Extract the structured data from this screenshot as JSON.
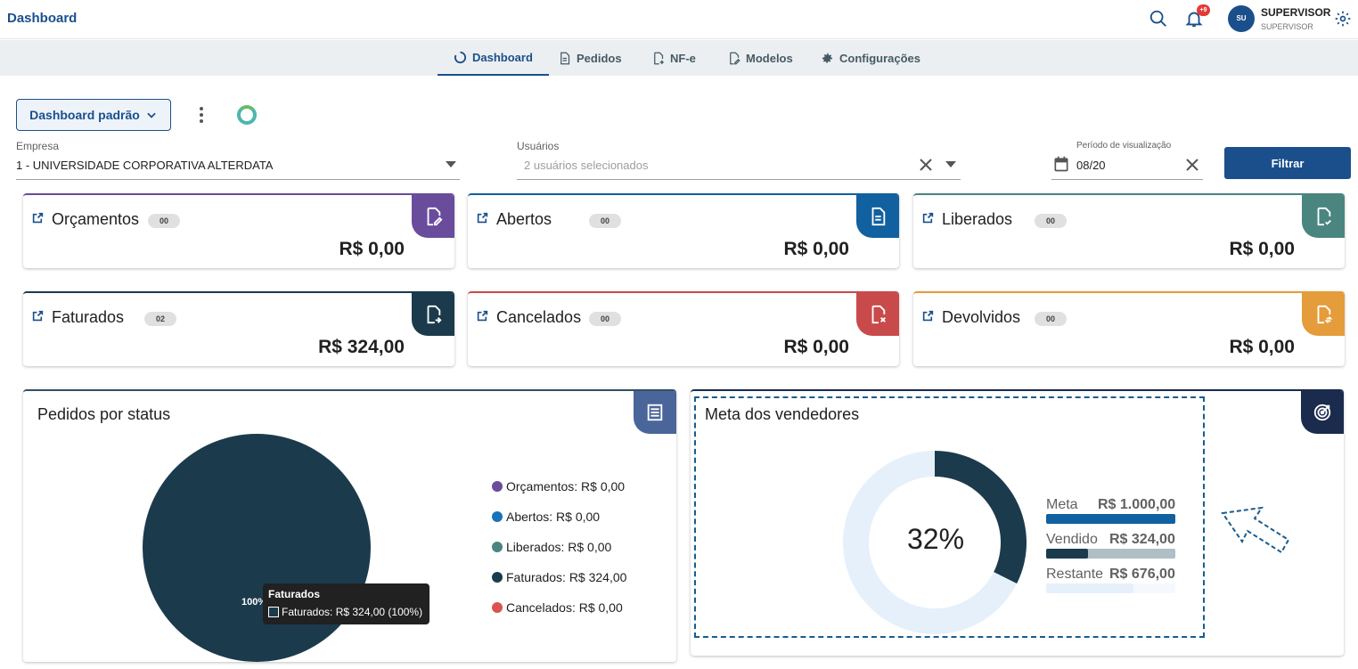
{
  "header": {
    "title": "Dashboard",
    "notification_badge": "+9",
    "user_initials": "SU",
    "user_name": "SUPERVISOR",
    "user_role": "SUPERVISOR"
  },
  "nav": {
    "tabs": [
      {
        "label": "Dashboard",
        "icon": "loading-circle-icon",
        "active": true
      },
      {
        "label": "Pedidos",
        "icon": "document-icon",
        "active": false
      },
      {
        "label": "NF-e",
        "icon": "document-arrow-icon",
        "active": false
      },
      {
        "label": "Modelos",
        "icon": "document-edit-icon",
        "active": false
      },
      {
        "label": "Configurações",
        "icon": "gear-icon",
        "active": false
      }
    ]
  },
  "toolbar": {
    "dashboard_select": "Dashboard padrão"
  },
  "filters": {
    "empresa_label": "Empresa",
    "empresa_value": "1 - UNIVERSIDADE CORPORATIVA ALTERDATA",
    "usuarios_label": "Usuários",
    "usuarios_value": "2 usuários selecionados",
    "periodo_label": "Período de visualização",
    "periodo_value": "08/20",
    "filter_button": "Filtrar"
  },
  "kpis": [
    {
      "name": "Orçamentos",
      "count": "00",
      "value": "R$ 0,00",
      "color": "#6a4c9c",
      "icon": "document-edit-icon"
    },
    {
      "name": "Abertos",
      "count": "00",
      "value": "R$ 0,00",
      "color": "#11609f",
      "icon": "document-icon"
    },
    {
      "name": "Liberados",
      "count": "00",
      "value": "R$ 0,00",
      "color": "#4a8580",
      "icon": "document-check-icon"
    },
    {
      "name": "Faturados",
      "count": "02",
      "value": "R$ 324,00",
      "color": "#1b3b4d",
      "icon": "document-arrow-icon"
    },
    {
      "name": "Cancelados",
      "count": "00",
      "value": "R$ 0,00",
      "color": "#c94a4a",
      "icon": "document-x-icon"
    },
    {
      "name": "Devolvidos",
      "count": "00",
      "value": "R$ 0,00",
      "color": "#e59c3a",
      "icon": "document-return-icon"
    }
  ],
  "status_panel": {
    "title": "Pedidos por status",
    "slice_label": "100%",
    "legend": [
      {
        "label": "Orçamentos: R$ 0,00",
        "color": "#6a4c9c"
      },
      {
        "label": "Abertos: R$ 0,00",
        "color": "#1a72b8"
      },
      {
        "label": "Liberados: R$ 0,00",
        "color": "#4a8580"
      },
      {
        "label": "Faturados: R$ 324,00",
        "color": "#1b3b4d"
      },
      {
        "label": "Cancelados: R$ 0,00",
        "color": "#d9534f"
      }
    ],
    "tooltip_title": "Faturados",
    "tooltip_text": "Faturados: R$ 324,00 (100%)"
  },
  "goal_panel": {
    "title": "Meta dos vendedores",
    "percent_label": "32%",
    "percent": 0.324,
    "meta_label": "Meta",
    "meta_value": "R$ 1.000,00",
    "vendido_label": "Vendido",
    "vendido_value": "R$ 324,00",
    "restante_label": "Restante",
    "restante_value": "R$ 676,00"
  },
  "chart_data": [
    {
      "type": "pie",
      "title": "Pedidos por status",
      "categories": [
        "Orçamentos",
        "Abertos",
        "Liberados",
        "Faturados",
        "Cancelados"
      ],
      "values": [
        0,
        0,
        0,
        324,
        0
      ],
      "colors": [
        "#6a4c9c",
        "#1a72b8",
        "#4a8580",
        "#1b3b4d",
        "#d9534f"
      ],
      "legend": "right"
    },
    {
      "type": "pie",
      "title": "Meta dos vendedores",
      "categories": [
        "Vendido",
        "Restante"
      ],
      "values": [
        324,
        676
      ],
      "colors": [
        "#1b3b4d",
        "#e6f0fb"
      ]
    }
  ]
}
